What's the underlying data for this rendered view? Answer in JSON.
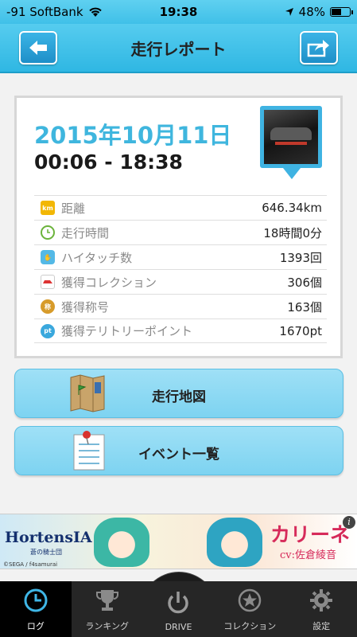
{
  "status_bar": {
    "carrier": "-91 SoftBank",
    "time": "19:38",
    "battery": "48%",
    "battery_level": 0.48
  },
  "header": {
    "title": "走行レポート",
    "back_icon": "back-arrow-icon",
    "share_icon": "share-icon"
  },
  "report": {
    "date": "2015年10月11日",
    "time_range": "00:06 - 18:38",
    "stats": [
      {
        "icon": "km-icon",
        "label": "距離",
        "value": "646.34km"
      },
      {
        "icon": "clock-icon",
        "label": "走行時間",
        "value": "18時間0分"
      },
      {
        "icon": "hand-icon",
        "label": "ハイタッチ数",
        "value": "1393回"
      },
      {
        "icon": "collection-car-icon",
        "label": "獲得コレクション",
        "value": "306個"
      },
      {
        "icon": "title-badge-icon",
        "label": "獲得称号",
        "value": "163個"
      },
      {
        "icon": "territory-icon",
        "label": "獲得テリトリーポイント",
        "value": "1670pt"
      }
    ]
  },
  "actions": {
    "map_label": "走行地図",
    "event_label": "イベント一覧"
  },
  "ad": {
    "brand": "HortensIA",
    "subtitle": "蒼の騎士団",
    "copyright": "©SEGA / f4samurai",
    "character_name": "カリーネ",
    "cv": "cv:佐倉綾音",
    "info": "i"
  },
  "tabs": [
    {
      "label": "ログ",
      "icon": "clock-icon",
      "active": true
    },
    {
      "label": "ランキング",
      "icon": "trophy-icon",
      "active": false
    },
    {
      "label": "DRIVE",
      "icon": "power-icon",
      "active": false
    },
    {
      "label": "コレクション",
      "icon": "star-icon",
      "active": false
    },
    {
      "label": "設定",
      "icon": "gear-icon",
      "active": false
    }
  ],
  "colors": {
    "accent": "#3fb6de",
    "header": "#2fb7e3",
    "tabbar": "#262626"
  }
}
